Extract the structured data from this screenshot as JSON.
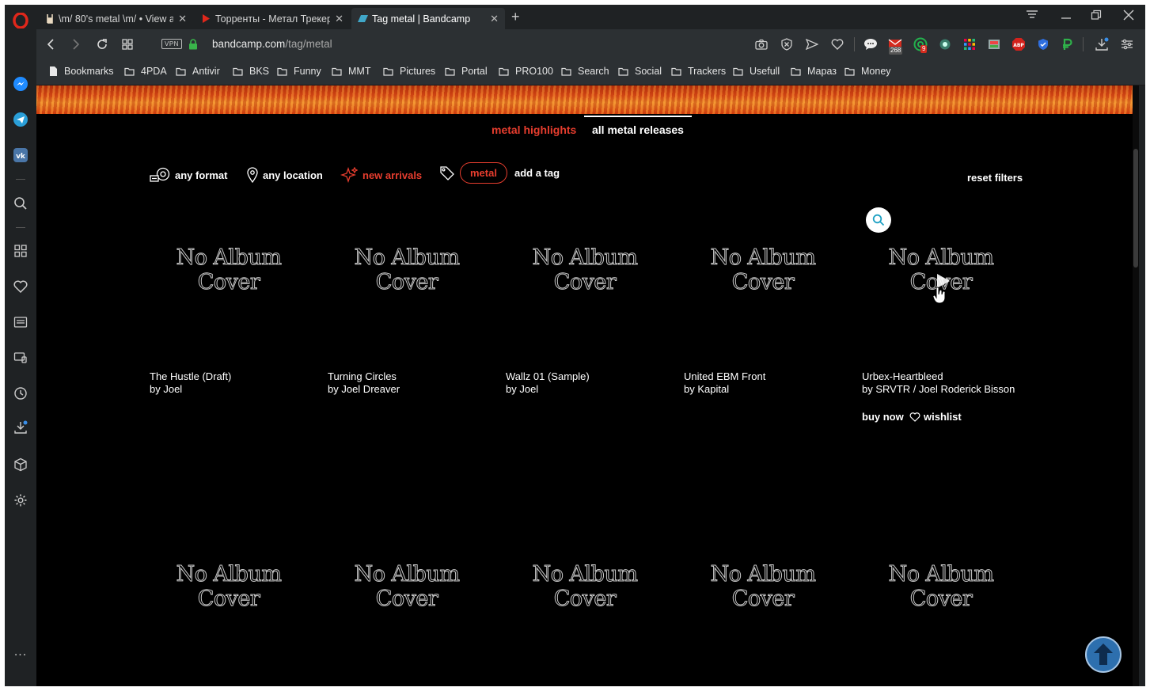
{
  "browser": {
    "tabs": [
      {
        "title": "\\m/ 80's metal \\m/ • View a",
        "close": "✕",
        "active": false
      },
      {
        "title": "Торренты - Метал Трекер",
        "close": "✕",
        "active": false
      },
      {
        "title": "Tag metal | Bandcamp",
        "close": "✕",
        "active": true
      }
    ],
    "new_tab": "+",
    "url_host": "bandcamp.com",
    "url_path": "/tag/metal",
    "vpn_label": "VPN",
    "mail_badge": "268",
    "notif_badge": "9",
    "bookmarks": [
      "Bookmarks",
      "4PDA",
      "Antivir",
      "BKS",
      "Funny",
      "MMT",
      "Pictures",
      "Portal",
      "PRO100",
      "Search",
      "Social",
      "Trackers",
      "Usefull",
      "Мараз",
      "Money"
    ],
    "sidebar_more": "..."
  },
  "page": {
    "subtabs": {
      "highlights": "metal highlights",
      "all": "all metal releases"
    },
    "filters": {
      "format": "any format",
      "location": "any location",
      "sort": "new arrivals",
      "tag": "metal",
      "add_tag": "add a tag",
      "reset": "reset filters"
    },
    "cover_line1": "No Album",
    "cover_line2": "Cover",
    "items": [
      {
        "title": "The Hustle (Draft)",
        "artist": "by Joel"
      },
      {
        "title": "Turning Circles",
        "artist": "by Joel Dreaver"
      },
      {
        "title": "Wallz 01 (Sample)",
        "artist": "by Joel"
      },
      {
        "title": "United EBM Front",
        "artist": "by Kapital"
      },
      {
        "title": "Urbex-Heartbleed",
        "artist": "by SRVTR / Joel Roderick Bisson"
      }
    ],
    "buy_now": "buy now",
    "wishlist": "wishlist"
  },
  "colors": {
    "accent": "#e63d2e",
    "page_bg": "#000000",
    "chrome_bg": "#2c3033"
  }
}
